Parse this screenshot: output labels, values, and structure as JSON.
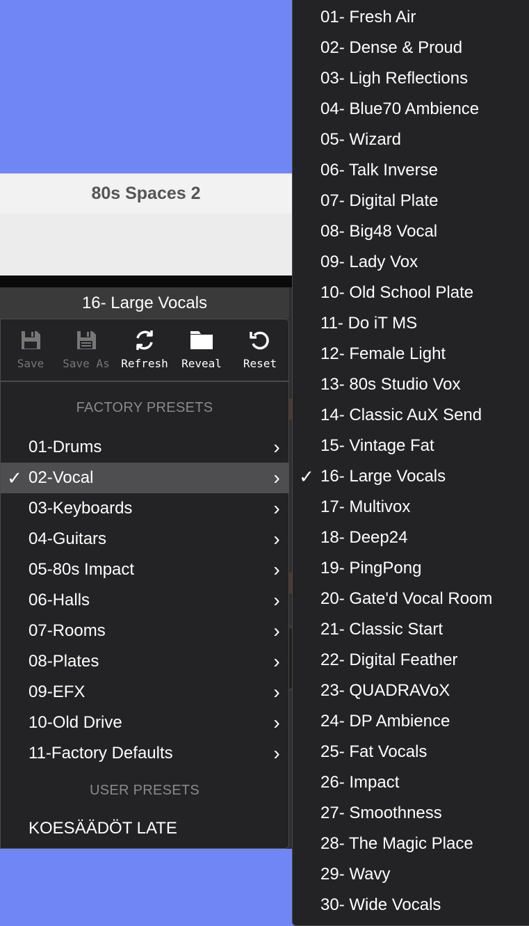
{
  "window": {
    "title": "80s Spaces 2"
  },
  "preset_header": {
    "current_preset": "16- Large Vocals"
  },
  "toolbar": {
    "save_label": "Save",
    "save_as_label": "Save As",
    "refresh_label": "Refresh",
    "reveal_label": "Reveal",
    "reset_label": "Reset"
  },
  "left_menu": {
    "factory_heading": "FACTORY PRESETS",
    "categories": [
      {
        "label": "01-Drums"
      },
      {
        "label": "02-Vocal"
      },
      {
        "label": "03-Keyboards"
      },
      {
        "label": "04-Guitars"
      },
      {
        "label": "05-80s Impact"
      },
      {
        "label": "06-Halls"
      },
      {
        "label": "07-Rooms"
      },
      {
        "label": "08-Plates"
      },
      {
        "label": "09-EFX"
      },
      {
        "label": "10-Old Drive"
      },
      {
        "label": "11-Factory Defaults"
      }
    ],
    "user_heading": "USER PRESETS",
    "user_presets": [
      {
        "label": "KOESÄÄDÖT LATE"
      }
    ]
  },
  "right_menu": {
    "presets": [
      {
        "label": "01- Fresh Air"
      },
      {
        "label": "02- Dense & Proud"
      },
      {
        "label": "03- Ligh Reflections"
      },
      {
        "label": "04- Blue70 Ambience"
      },
      {
        "label": "05- Wizard"
      },
      {
        "label": "06- Talk Inverse"
      },
      {
        "label": "07- Digital Plate"
      },
      {
        "label": "08- Big48 Vocal"
      },
      {
        "label": "09- Lady Vox"
      },
      {
        "label": "10- Old School Plate"
      },
      {
        "label": "11- Do iT MS"
      },
      {
        "label": "12- Female Light"
      },
      {
        "label": "13- 80s Studio Vox"
      },
      {
        "label": "14- Classic AuX Send"
      },
      {
        "label": "15- Vintage Fat"
      },
      {
        "label": "16- Large Vocals"
      },
      {
        "label": "17- Multivox"
      },
      {
        "label": "18- Deep24"
      },
      {
        "label": "19- PingPong"
      },
      {
        "label": "20- Gate'd Vocal Room"
      },
      {
        "label": "21- Classic Start"
      },
      {
        "label": "22- Digital Feather"
      },
      {
        "label": "23- QUADRAVoX"
      },
      {
        "label": "24- DP Ambience"
      },
      {
        "label": "25- Fat Vocals"
      },
      {
        "label": "26- Impact"
      },
      {
        "label": "27- Smoothness"
      },
      {
        "label": "28- The Magic Place"
      },
      {
        "label": "29- Wavy"
      },
      {
        "label": "30- Wide Vocals"
      }
    ]
  },
  "check_glyph": "✓",
  "chevron_glyph": "›"
}
